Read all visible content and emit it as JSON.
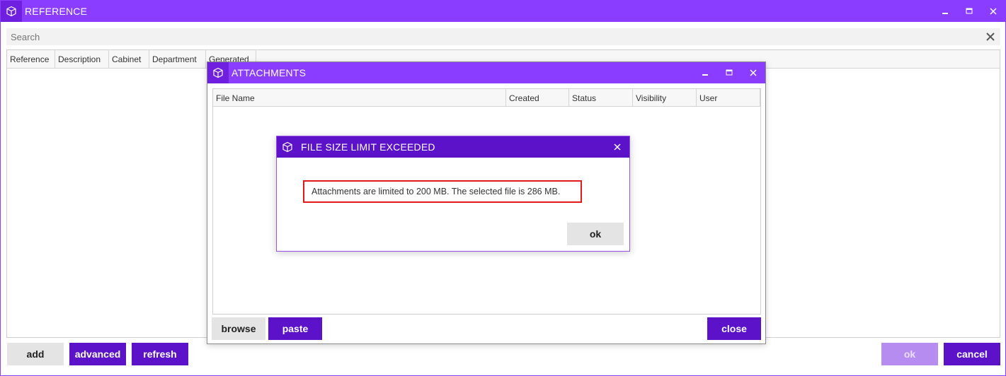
{
  "main_window": {
    "title": "REFERENCE",
    "search": {
      "placeholder": "Search",
      "value": ""
    },
    "columns": [
      "Reference",
      "Description",
      "Cabinet",
      "Department",
      "Generated"
    ],
    "buttons": {
      "add": "add",
      "advanced": "advanced",
      "refresh": "refresh",
      "ok": "ok",
      "cancel": "cancel"
    }
  },
  "attachments_window": {
    "title": "ATTACHMENTS",
    "columns": [
      "File Name",
      "Created",
      "Status",
      "Visibility",
      "User"
    ],
    "buttons": {
      "browse": "browse",
      "paste": "paste",
      "close": "close"
    }
  },
  "dialog": {
    "title": "FILE SIZE LIMIT EXCEEDED",
    "message": "Attachments are limited to 200 MB. The selected file is 286 MB.",
    "ok_label": "ok"
  },
  "colors": {
    "title_bar": "#8b3dff",
    "dialog_title_bar": "#5b12c8",
    "primary_button": "#5b12c8",
    "disabled_button": "#b68cf0",
    "highlight_border": "#e0191b"
  },
  "icons": [
    "app-cube-icon",
    "minimize-icon",
    "maximize-icon",
    "close-icon",
    "clear-search-icon"
  ]
}
